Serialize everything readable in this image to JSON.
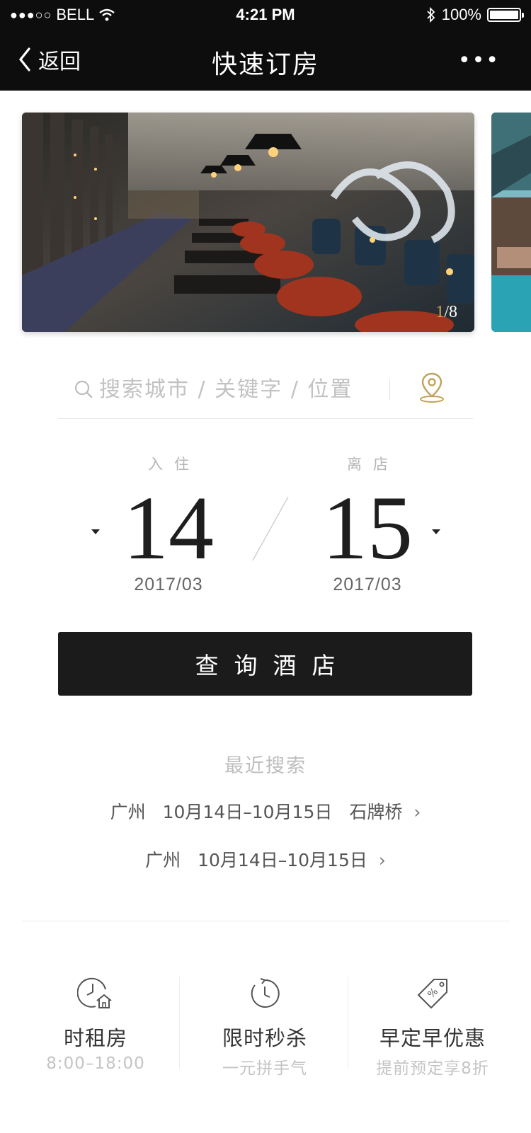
{
  "status": {
    "carrier": "BELL",
    "time": "4:21 PM",
    "battery": "100%"
  },
  "nav": {
    "back_label": "返回",
    "title": "快速订房",
    "more_label": "•••"
  },
  "carousel": {
    "current": "1",
    "total": "/8"
  },
  "search": {
    "placeholder": "搜索城市 / 关键字 / 位置"
  },
  "checkin": {
    "label": "入住",
    "day": "14",
    "month": "2017/03"
  },
  "checkout": {
    "label": "离店",
    "day": "15",
    "month": "2017/03"
  },
  "query_button": "查询酒店",
  "recent": {
    "title": "最近搜索",
    "items": [
      {
        "city": "广州",
        "dates": "10月14日–10月15日",
        "place": "石牌桥"
      },
      {
        "city": "广州",
        "dates": "10月14日–10月15日",
        "place": ""
      }
    ]
  },
  "features": [
    {
      "name": "时租房",
      "sub": "8:00–18:00",
      "icon": "clock-home-icon"
    },
    {
      "name": "限时秒杀",
      "sub": "一元拼手气",
      "icon": "countdown-clock-icon"
    },
    {
      "name": "早定早优惠",
      "sub": "提前预定享8折",
      "icon": "discount-tag-icon"
    }
  ],
  "colors": {
    "topbar": "#0d0d0d",
    "button": "#1b1b1b",
    "gold_accent": "#caa55b"
  }
}
